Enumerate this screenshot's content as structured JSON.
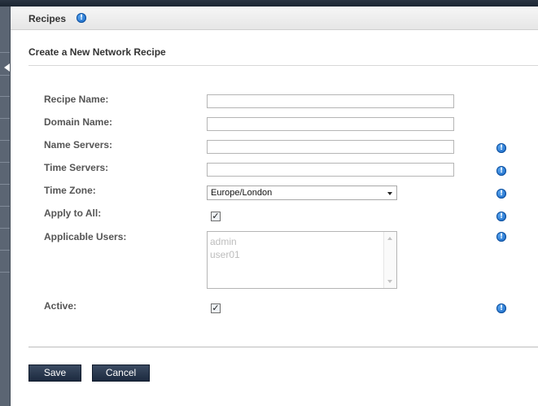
{
  "header": {
    "title": "Recipes",
    "info_icon": "info-icon"
  },
  "form": {
    "title": "Create a New Network Recipe",
    "fields": {
      "recipe_name": {
        "label": "Recipe Name:",
        "value": ""
      },
      "domain_name": {
        "label": "Domain Name:",
        "value": ""
      },
      "name_servers": {
        "label": "Name Servers:",
        "value": ""
      },
      "time_servers": {
        "label": "Time Servers:",
        "value": ""
      },
      "time_zone": {
        "label": "Time Zone:",
        "value": "Europe/London"
      },
      "apply_to_all": {
        "label": "Apply to All:",
        "checked": true
      },
      "applicable_users": {
        "label": "Applicable Users:",
        "options": [
          "admin",
          "user01"
        ]
      },
      "active": {
        "label": "Active:",
        "checked": true
      }
    }
  },
  "buttons": {
    "save": "Save",
    "cancel": "Cancel"
  },
  "colors": {
    "info_icon": "#1a6fd1",
    "button_bg": "#2a3a52",
    "header_bg": "#ececec"
  }
}
